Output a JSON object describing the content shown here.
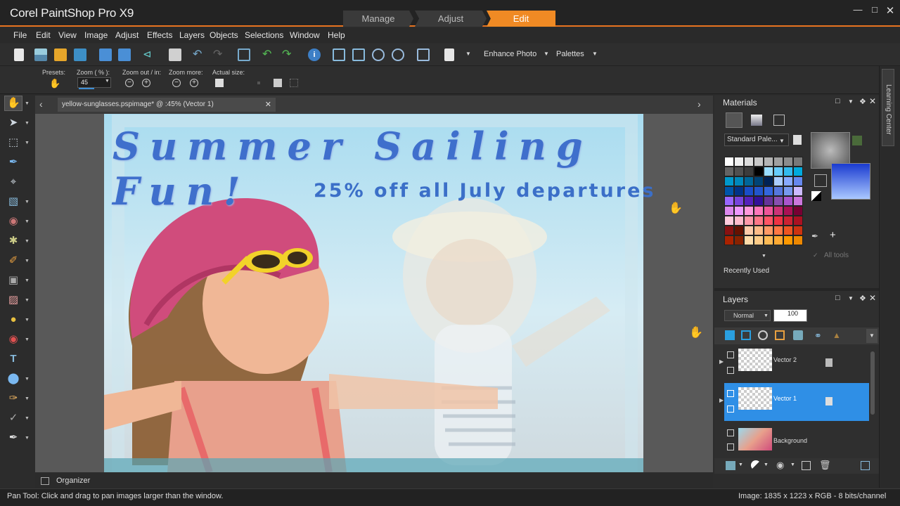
{
  "app": {
    "title": "Corel PaintShop Pro X9"
  },
  "workspace_tabs": [
    {
      "label": "Manage",
      "active": false
    },
    {
      "label": "Adjust",
      "active": false
    },
    {
      "label": "Edit",
      "active": true
    }
  ],
  "menu": [
    "File",
    "Edit",
    "View",
    "Image",
    "Adjust",
    "Effects",
    "Layers",
    "Objects",
    "Selections",
    "Window",
    "Help"
  ],
  "toolbar": {
    "enhance_photo": "Enhance Photo",
    "palettes": "Palettes"
  },
  "options": {
    "presets_label": "Presets:",
    "zoom_label": "Zoom ( % ):",
    "zoom_value": "45",
    "zoom_out_in_label": "Zoom out / in:",
    "zoom_more_label": "Zoom more:",
    "actual_size_label": "Actual size:"
  },
  "document": {
    "tab_label": "yellow-sunglasses.pspimage* @ :45% (Vector 1)"
  },
  "image_text": {
    "headline": "Summer Sailing Fun!",
    "subline": "25% off all July departures"
  },
  "materials": {
    "title": "Materials",
    "palette_select": "Standard Pale...",
    "all_tools": "All tools",
    "recently_used": "Recently Used",
    "swatches": [
      "#ffffff",
      "#f0f0f0",
      "#dcdcdc",
      "#c8c8c8",
      "#b4b4b4",
      "#a0a0a0",
      "#8c8c8c",
      "#787878",
      "#646464",
      "#505050",
      "#3c3c3c",
      "#000000",
      "#99ddff",
      "#66ccff",
      "#33bbee",
      "#00aadd",
      "#0099cc",
      "#0088bb",
      "#006699",
      "#004477",
      "#002255",
      "#aaccff",
      "#88aaff",
      "#6688ee",
      "#0055aa",
      "#003388",
      "#1a4ec8",
      "#2255cc",
      "#3366dd",
      "#5577dd",
      "#7799ee",
      "#ccbbff",
      "#9966ff",
      "#7744dd",
      "#5522bb",
      "#331199",
      "#663399",
      "#884fb0",
      "#aa55cc",
      "#cc77dd",
      "#dd88ee",
      "#ee99ff",
      "#ff99dd",
      "#ff77bb",
      "#ee5599",
      "#cc3377",
      "#aa1155",
      "#770033",
      "#ffccdd",
      "#ffbbcc",
      "#ff99aa",
      "#ff7788",
      "#ff5566",
      "#ee3344",
      "#cc2233",
      "#aa1122",
      "#881111",
      "#661100",
      "#ffccaa",
      "#ffbb88",
      "#ff9966",
      "#ff7744",
      "#ee5522",
      "#cc3311",
      "#aa2200",
      "#882200",
      "#ffddaa",
      "#ffcc88",
      "#ffbb55",
      "#ffaa33",
      "#ff9900",
      "#ee8800"
    ]
  },
  "layers": {
    "title": "Layers",
    "blend_mode": "Normal",
    "opacity": "100",
    "items": [
      {
        "name": "Vector 2",
        "selected": false
      },
      {
        "name": "Vector 1",
        "selected": true
      },
      {
        "name": "Background",
        "selected": false
      }
    ]
  },
  "learning_center": "Learning Center",
  "organizer": "Organizer",
  "status": {
    "left": "Pan Tool: Click and drag to pan images larger than the window.",
    "right": "Image:  1835 x 1223 x RGB - 8 bits/channel"
  },
  "colors": {
    "accent": "#f08a24",
    "selected_layer": "#2f8fe6",
    "headline": "#3f6fcc"
  }
}
